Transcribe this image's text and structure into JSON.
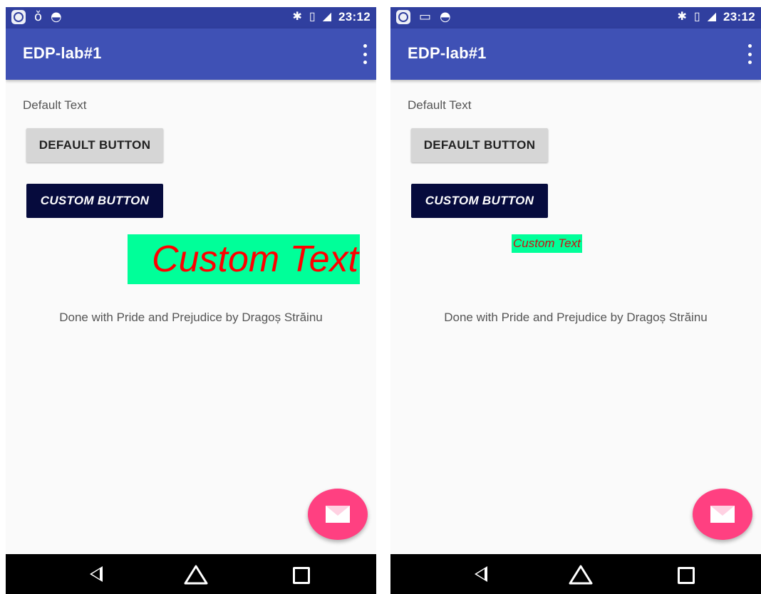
{
  "status_bar": {
    "time": "23:12",
    "icons_left_a": [
      "app-icon",
      "bulb-icon",
      "android-icon"
    ],
    "icons_left_b": [
      "app-icon",
      "image-icon",
      "android-icon"
    ],
    "icons_right": [
      "bluetooth-icon",
      "vibrate-icon",
      "signal-hplus-icon"
    ]
  },
  "app_bar": {
    "title": "EDP-lab#1"
  },
  "content": {
    "default_text": "Default Text",
    "default_button": "DEFAULT BUTTON",
    "custom_button": "CUSTOM BUTTON",
    "custom_text": "Custom Text",
    "footer": "Done with Pride and Prejudice by Dragoș Străinu"
  },
  "fab": {
    "icon": "email-icon"
  },
  "nav_bar": {
    "icons": [
      "back-icon",
      "home-icon",
      "recents-icon"
    ]
  },
  "colors": {
    "status_bar": "#303f9f",
    "app_bar": "#3f51b5",
    "fab": "#ff4081",
    "custom_button": "#060b3d",
    "custom_text_bg": "#00ff99",
    "custom_text_fg": "#ff0000"
  }
}
